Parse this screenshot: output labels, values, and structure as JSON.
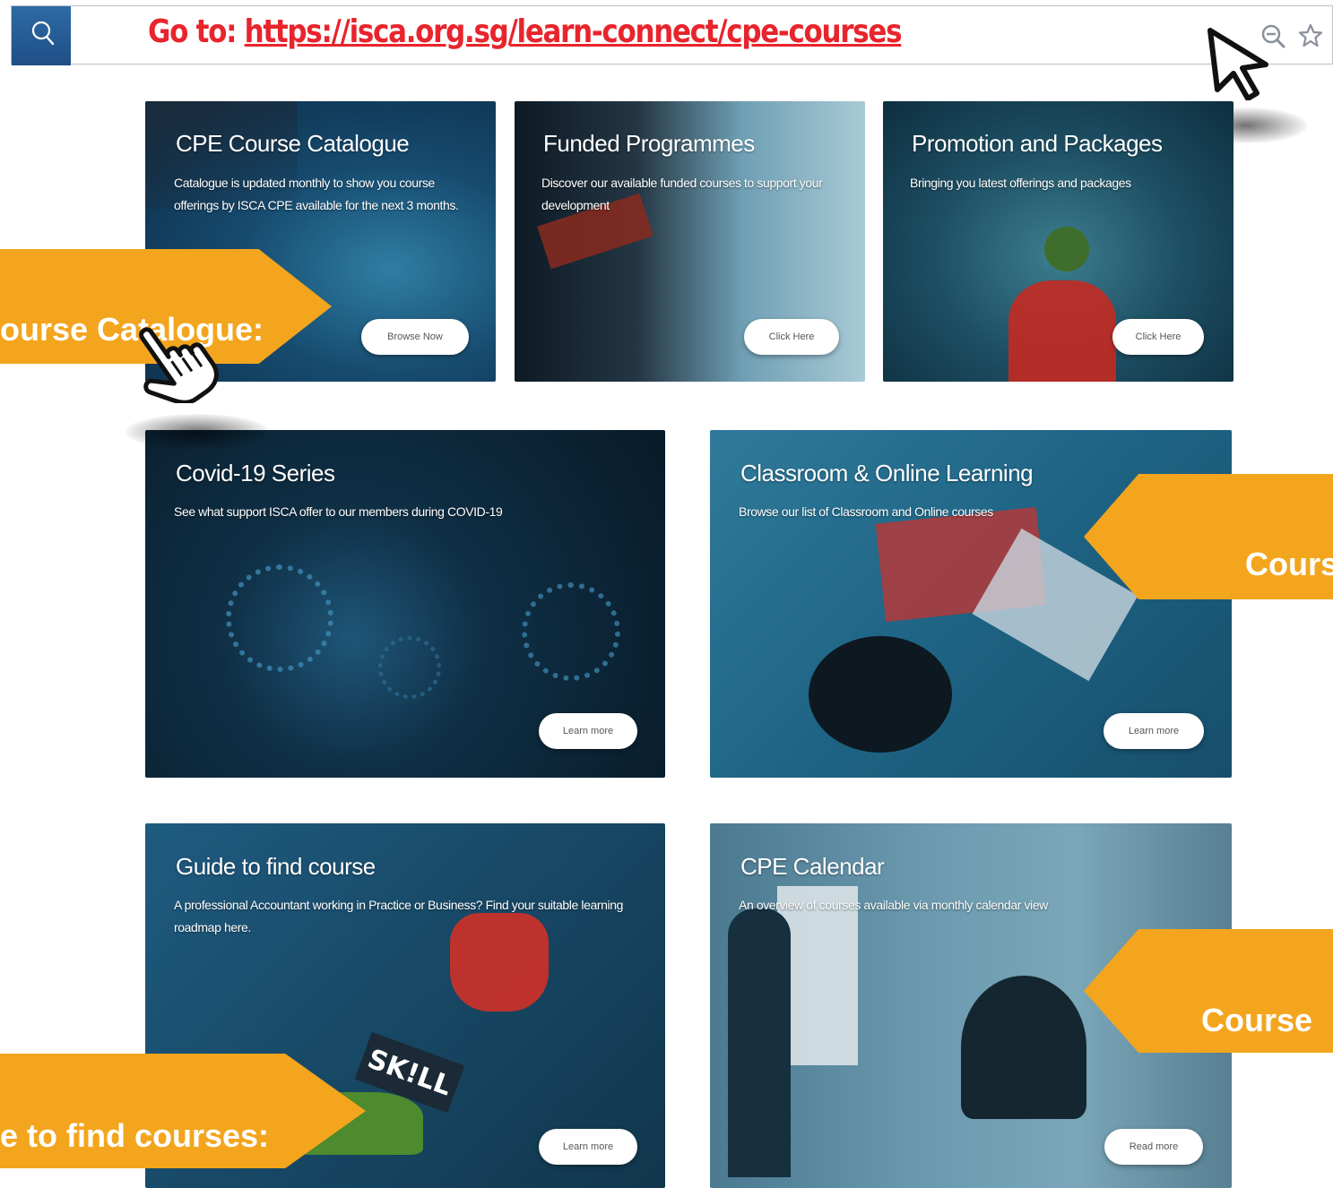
{
  "address_bar": {
    "prefix": "Go to: ",
    "url": "https://isca.org.sg/learn-connect/cpe-courses"
  },
  "cards": [
    {
      "title": "CPE Course Catalogue",
      "description": "Catalogue is updated monthly to show you course offerings by ISCA CPE available for the next 3 months.",
      "button": "Browse Now"
    },
    {
      "title": "Funded Programmes",
      "description": "Discover our available funded courses to support your development",
      "button": "Click Here"
    },
    {
      "title": "Promotion and Packages",
      "description": "Bringing you latest offerings and packages",
      "button": "Click Here"
    },
    {
      "title": "Covid-19 Series",
      "description": "See what support ISCA offer to our members during COVID-19",
      "button": "Learn more"
    },
    {
      "title": "Classroom & Online Learning",
      "description": "Browse our list of Classroom and Online courses",
      "button": "Learn more"
    },
    {
      "title": "Guide to find course",
      "description": "A professional Accountant working in Practice or Business? Find your suitable learning roadmap here.",
      "button": "Learn more"
    },
    {
      "title": "CPE Calendar",
      "description": "An overview of courses available via monthly calendar view",
      "button": "Read more"
    }
  ],
  "callouts": {
    "catalogue": "ourse Catalogue:",
    "classroom": "Cours",
    "calendar": "Course",
    "guide": "e to find courses:"
  },
  "colors": {
    "callout": "#f3a51e",
    "goto_text": "#e8242c",
    "search_box": "#1f4f86"
  },
  "icons": [
    "search-icon",
    "zoom-out-icon",
    "star-icon",
    "arrow-cursor-icon",
    "hand-pointer-icon"
  ]
}
